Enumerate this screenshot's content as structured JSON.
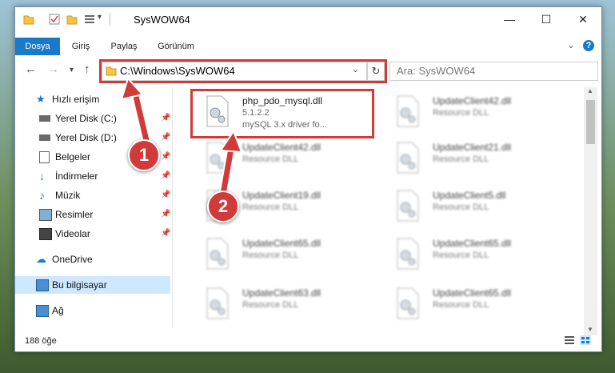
{
  "window": {
    "title": "SysWOW64",
    "min": "—",
    "max": "☐",
    "close": "✕"
  },
  "ribbon": {
    "tabs": [
      {
        "label": "Dosya"
      },
      {
        "label": "Giriş"
      },
      {
        "label": "Paylaş"
      },
      {
        "label": "Görünüm"
      }
    ],
    "help": "?"
  },
  "nav": {
    "address": "C:\\Windows\\SysWOW64",
    "search_placeholder": "Ara: SysWOW64"
  },
  "sidebar": {
    "items": [
      {
        "label": "Hızlı erişim"
      },
      {
        "label": "Yerel Disk (C:)"
      },
      {
        "label": "Yerel Disk (D:)"
      },
      {
        "label": "Belgeler"
      },
      {
        "label": "İndirmeler"
      },
      {
        "label": "Müzik"
      },
      {
        "label": "Resimler"
      },
      {
        "label": "Videolar"
      },
      {
        "label": "OneDrive"
      },
      {
        "label": "Bu bilgisayar"
      },
      {
        "label": "Ağ"
      }
    ]
  },
  "files": [
    {
      "name": "php_pdo_mysql.dll",
      "line1": "5.1.2.2",
      "line2": "mySQL 3.x driver fo..."
    },
    {
      "name": "UpdateClient42.dll",
      "line1": "Resource DLL",
      "line2": ""
    },
    {
      "name": "UpdateClient42.dll",
      "line1": "Resource DLL",
      "line2": ""
    },
    {
      "name": "UpdateClient21.dll",
      "line1": "Resource DLL",
      "line2": ""
    },
    {
      "name": "UpdateClient19.dll",
      "line1": "Resource DLL",
      "line2": ""
    },
    {
      "name": "UpdateClient5.dll",
      "line1": "Resource DLL",
      "line2": ""
    },
    {
      "name": "UpdateClient65.dll",
      "line1": "Resource DLL",
      "line2": ""
    },
    {
      "name": "UpdateClient65.dll",
      "line1": "Resource DLL",
      "line2": ""
    },
    {
      "name": "UpdateClient63.dll",
      "line1": "Resource DLL",
      "line2": ""
    },
    {
      "name": "UpdateClient65.dll",
      "line1": "Resource DLL",
      "line2": ""
    }
  ],
  "status": {
    "count": "188 öğe"
  },
  "annotations": {
    "step1": "1",
    "step2": "2",
    "color": "#d23a3a"
  }
}
